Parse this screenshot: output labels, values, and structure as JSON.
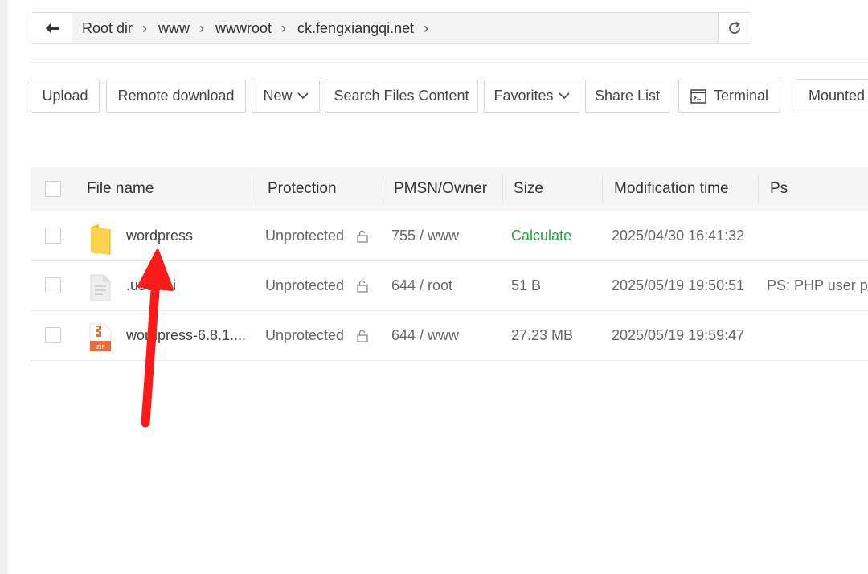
{
  "pathbar": {
    "back_icon": "back-arrow-icon",
    "crumbs": [
      "Root dir",
      "www",
      "wwwroot",
      "ck.fengxiangqi.net"
    ],
    "refresh_icon": "refresh-icon"
  },
  "toolbar": {
    "upload": "Upload",
    "remote_download": "Remote download",
    "new": "New",
    "search_files_content": "Search Files Content",
    "favorites": "Favorites",
    "share_list": "Share List",
    "terminal": "Terminal",
    "mounted": "Mounted"
  },
  "table": {
    "headers": {
      "file_name": "File name",
      "protection": "Protection",
      "pmsn_owner": "PMSN/Owner",
      "size": "Size",
      "modification_time": "Modification time",
      "ps": "Ps"
    },
    "rows": [
      {
        "name": "wordpress",
        "icon": "folder-icon",
        "protection": "Unprotected",
        "pmsn": "755 / www",
        "size": "Calculate",
        "mtime": "2025/04/30 16:41:32",
        "ps": ""
      },
      {
        "name": ".user.ini",
        "icon": "text-file-icon",
        "protection": "Unprotected",
        "pmsn": "644 / root",
        "size": "51 B",
        "mtime": "2025/05/19 19:50:51",
        "ps": "PS: PHP user pro"
      },
      {
        "name": "wordpress-6.8.1....",
        "icon": "zip-file-icon",
        "protection": "Unprotected",
        "pmsn": "644 / www",
        "size": "27.23 MB",
        "mtime": "2025/05/19 19:59:47",
        "ps": ""
      }
    ]
  },
  "colors": {
    "accent_green": "#20a53a",
    "annotation_red": "#ff1a1a"
  }
}
